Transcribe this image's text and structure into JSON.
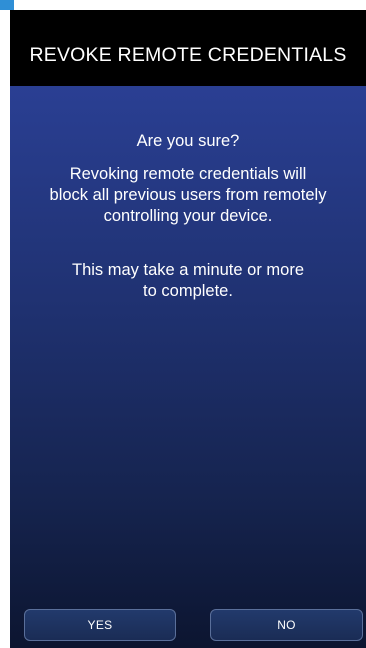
{
  "header": {
    "title": "REVOKE REMOTE CREDENTIALS"
  },
  "dialog": {
    "question": "Are you sure?",
    "body_lines": [
      "Revoking remote credentials will",
      "block all previous users from remotely",
      "controlling your device."
    ],
    "note_lines": [
      "This may take a minute or more",
      "to complete."
    ]
  },
  "buttons": {
    "yes_label": "YES",
    "no_label": "NO"
  },
  "colors": {
    "accent_tab": "#2f8fd6",
    "header_bg": "#000000",
    "content_gradient_top": "#2a3f93",
    "content_gradient_bottom": "#0c1530"
  }
}
